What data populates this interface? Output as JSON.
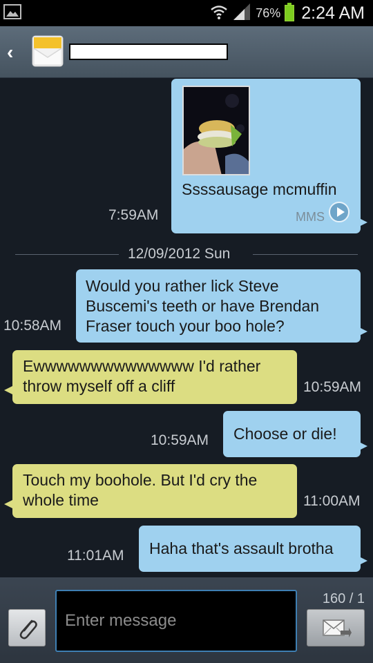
{
  "status_bar": {
    "battery_percent": "76%",
    "time": "2:24 AM"
  },
  "header": {
    "contact_name": ""
  },
  "thread": {
    "mms": {
      "caption": "Ssssausage mcmuffin",
      "time": "7:59AM",
      "label": "MMS"
    },
    "date_separator": "12/09/2012 Sun",
    "messages": [
      {
        "direction": "out",
        "text": "Would you rather lick Steve Buscemi's teeth or have Brendan Fraser touch your boo hole?",
        "time": "10:58AM"
      },
      {
        "direction": "in",
        "text": "Ewwwwwwwwwwwwww I'd rather throw myself off a cliff",
        "time": "10:59AM"
      },
      {
        "direction": "out",
        "text": "Choose or die!",
        "time": "10:59AM"
      },
      {
        "direction": "in",
        "text": "Touch my boohole. But I'd cry the whole time",
        "time": "11:00AM"
      },
      {
        "direction": "out",
        "text": "Haha that's assault brotha",
        "time": "11:01AM"
      }
    ]
  },
  "composer": {
    "placeholder": "Enter message",
    "char_count": "160 / 1"
  },
  "colors": {
    "outgoing_bubble": "#9fd1ef",
    "incoming_bubble": "#dcdd82",
    "background": "#161c24"
  },
  "icons": {
    "status_left": "gallery-icon",
    "wifi": "wifi-icon",
    "signal": "signal-icon",
    "battery": "battery-icon",
    "back": "back-arrow-icon",
    "contact": "envelope-icon",
    "play": "play-icon",
    "attach": "paperclip-icon",
    "send": "send-icon"
  }
}
